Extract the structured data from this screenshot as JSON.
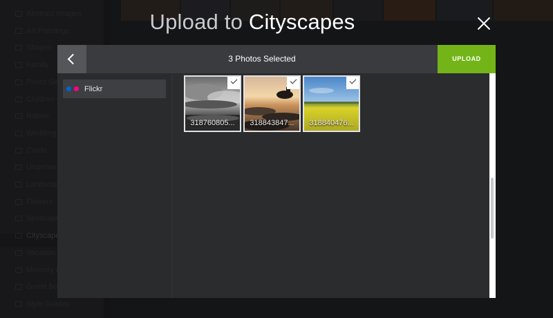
{
  "background": {
    "sidebar_items": [
      {
        "label": "Abstract Images",
        "active": false
      },
      {
        "label": "Art Paintings",
        "active": false
      },
      {
        "label": "Shapes",
        "active": false
      },
      {
        "label": "Family",
        "active": false
      },
      {
        "label": "Photo Set",
        "active": false
      },
      {
        "label": "Children",
        "active": false
      },
      {
        "label": "Nature",
        "active": false
      },
      {
        "label": "Wedding",
        "active": false
      },
      {
        "label": "Cards",
        "active": false
      },
      {
        "label": "Underwater",
        "active": false
      },
      {
        "label": "Landscapes",
        "active": false
      },
      {
        "label": "Flowers",
        "active": false
      },
      {
        "label": "Seascapes",
        "active": false
      },
      {
        "label": "Cityscapes",
        "active": true
      },
      {
        "label": "Vacation",
        "active": false
      },
      {
        "label": "Memory Book",
        "active": false
      },
      {
        "label": "Guest Book",
        "active": false
      },
      {
        "label": "Style Guides",
        "active": false
      }
    ]
  },
  "modal": {
    "title_prefix": "Upload to",
    "title_album": "Cityscapes",
    "selected_text": "3 Photos Selected",
    "upload_label": "UPLOAD",
    "back_icon": "chevron-left-icon",
    "close_icon": "close-icon"
  },
  "sources": [
    {
      "label": "Flickr",
      "icon": "flickr-icon",
      "colors": [
        "#0063dc",
        "#ff0084"
      ]
    }
  ],
  "photos": [
    {
      "name": "318760805...",
      "selected": true,
      "theme": "bw-clouds"
    },
    {
      "name": "318843847...",
      "selected": true,
      "theme": "sunset-rocks"
    },
    {
      "name": "318840476...",
      "selected": true,
      "theme": "rapeseed-field"
    }
  ],
  "colors": {
    "accent": "#73b519",
    "panel": "#2b2c2e",
    "topbar": "#3a3b3e"
  }
}
